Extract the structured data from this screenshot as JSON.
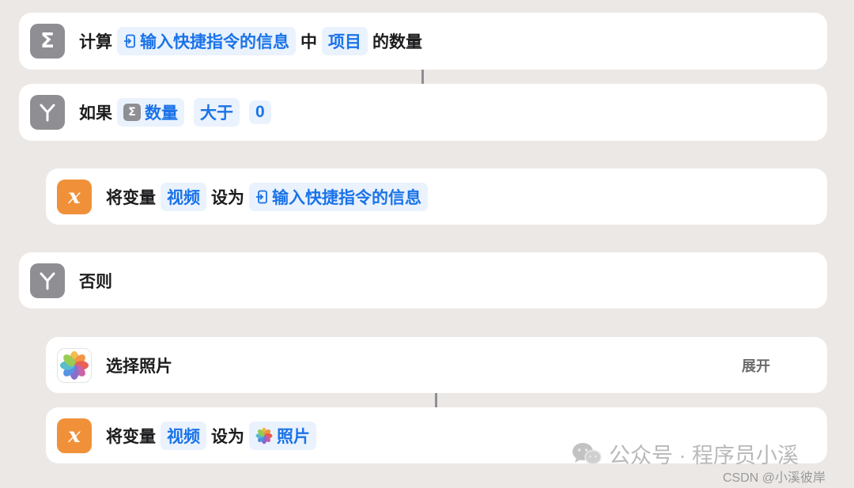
{
  "blocks": {
    "count": {
      "prefix": "计算",
      "input_token": "输入快捷指令的信息",
      "mid": "中",
      "items_token": "项目",
      "suffix": "的数量"
    },
    "if_block": {
      "label": "如果",
      "var_token": "数量",
      "operator_token": "大于",
      "value_token": "0"
    },
    "set_var_1": {
      "label": "将变量",
      "var_token": "视频",
      "setto": "设为",
      "value_token": "输入快捷指令的信息"
    },
    "otherwise": {
      "label": "否则"
    },
    "select_photos": {
      "label": "选择照片",
      "expand": "展开"
    },
    "set_var_2": {
      "label": "将变量",
      "var_token": "视频",
      "setto": "设为",
      "value_token": "照片"
    }
  },
  "watermark": {
    "wechat": "公众号 · 程序员小溪",
    "csdn": "CSDN @小溪彼岸"
  },
  "icons": {
    "calculate": "sigma-icon",
    "if": "branch-icon",
    "otherwise": "branch-icon",
    "set_variable": "variable-x-icon",
    "photos": "photos-app-icon",
    "shortcut_input": "shortcut-input-icon"
  },
  "colors": {
    "background": "#ebe8e6",
    "card": "#ffffff",
    "token_text": "#1a73e8",
    "token_bg": "#eaf2fd",
    "gray_icon": "#8e8e93",
    "orange_icon": "#f0913a"
  }
}
